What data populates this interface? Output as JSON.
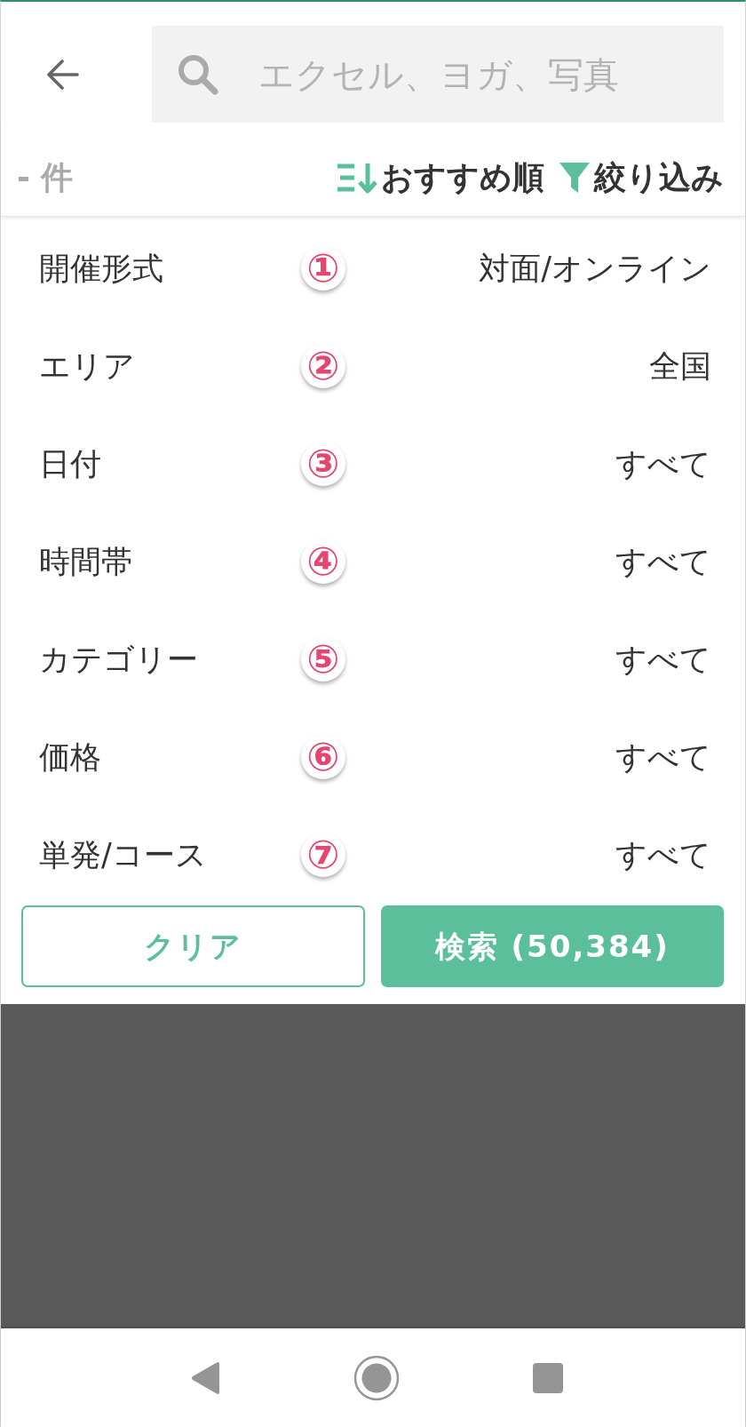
{
  "search": {
    "placeholder": "エクセル、ヨガ、写真"
  },
  "toolbar": {
    "result_count": "- 件",
    "actions": [
      {
        "kind": "sort",
        "label": "おすすめ順"
      },
      {
        "kind": "filter",
        "label": "絞り込み"
      }
    ]
  },
  "filters": [
    {
      "label": "開催形式",
      "marker": "①",
      "value": "対面/オンライン"
    },
    {
      "label": "エリア",
      "marker": "②",
      "value": "全国"
    },
    {
      "label": "日付",
      "marker": "③",
      "value": "すべて"
    },
    {
      "label": "時間帯",
      "marker": "④",
      "value": "すべて"
    },
    {
      "label": "カテゴリー",
      "marker": "⑤",
      "value": "すべて"
    },
    {
      "label": "価格",
      "marker": "⑥",
      "value": "すべて"
    },
    {
      "label": "単発/コース",
      "marker": "⑦",
      "value": "すべて"
    }
  ],
  "buttons": [
    {
      "kind": "outline",
      "label": "クリア"
    },
    {
      "kind": "primary",
      "label": "検索 (50,384)"
    }
  ]
}
